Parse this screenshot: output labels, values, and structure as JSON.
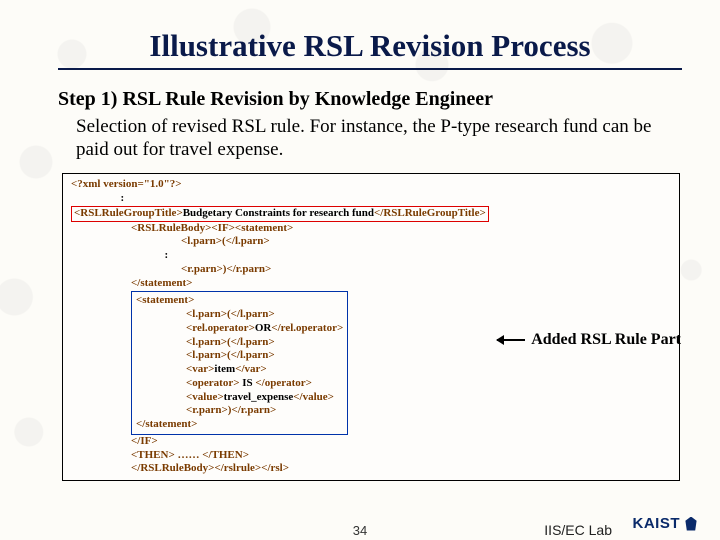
{
  "title": "Illustrative RSL Revision Process",
  "step_heading": "Step 1) RSL Rule Revision by Knowledge Engineer",
  "step_desc": "Selection of revised RSL rule. For instance, the P-type research fund can be paid out for travel expense.",
  "code": {
    "l1": "<?xml version=\"1.0\"?>",
    "dots1": ":",
    "group_open": "<RSLRuleGroupTitle>",
    "group_text": "Budgetary Constraints for research fund",
    "group_close": "</RSLRuleGroupTitle>",
    "l3": "<RSLRuleBody><IF><statement>",
    "l4": "<l.parn>(</l.parn>",
    "dots2": ":",
    "l5": "<r.parn>)</r.parn>",
    "l6": "</statement>",
    "add1": "<statement>",
    "add2": "<l.parn>(</l.parn>",
    "add3_a": "<rel.operator>",
    "add3_b": "OR",
    "add3_c": "</rel.operator>",
    "add4": "<l.parn>(</l.parn>",
    "add5": "<l.parn>(</l.parn>",
    "add6_a": "<var>",
    "add6_b": "item",
    "add6_c": "</var>",
    "add7_a": "<operator>",
    "add7_b": " IS ",
    "add7_c": "</operator>",
    "add8_a": "<value>",
    "add8_b": "travel_expense",
    "add8_c": "</value>",
    "add9": "<r.parn>)</r.parn>",
    "add10": "</statement>",
    "l7": "</IF>",
    "l8": "<THEN> ……    </THEN>",
    "l9": "</RSLRuleBody></rslrule></rsl>"
  },
  "added_label": "Added RSL Rule Part",
  "page_number": "34",
  "lab": "IIS/EC Lab",
  "logo": "KAIST"
}
